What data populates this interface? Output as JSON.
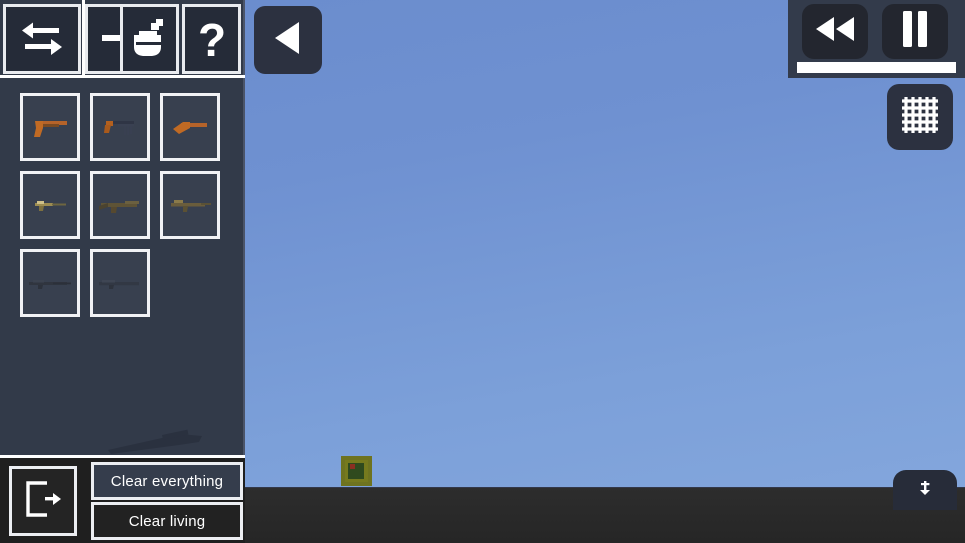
{
  "scene": {
    "sky_color_top": "#6a8ccd",
    "sky_color_bottom": "#83a6dc",
    "ground_color": "#2b2b2b",
    "entity": {
      "name": "crate-entity",
      "color": "#767a1e"
    }
  },
  "sidebar": {
    "background": "#323a49",
    "toolbar": [
      {
        "id": "swap-button",
        "icon": "swap-arrows-icon",
        "label": "Swap"
      },
      {
        "id": "arrow-button",
        "icon": "arrow-right-icon",
        "label": "Arrow"
      },
      {
        "id": "grenade-button",
        "icon": "grenade-icon",
        "label": "Grenade"
      },
      {
        "id": "help-button",
        "icon": "question-mark-icon",
        "label": "Help"
      }
    ],
    "weapons": [
      {
        "id": "weapon-pistol",
        "label": "Pistol",
        "tint": "#c2641e"
      },
      {
        "id": "weapon-machine-pistol",
        "label": "Machine Pistol",
        "tint": "#b35c1c"
      },
      {
        "id": "weapon-sawed-off",
        "label": "Sawed-off",
        "tint": "#c4661f"
      },
      {
        "id": "weapon-smg",
        "label": "SMG",
        "tint": "#8a7a4a"
      },
      {
        "id": "weapon-assault-rifle",
        "label": "Assault Rifle",
        "tint": "#6e5f3a"
      },
      {
        "id": "weapon-carbine",
        "label": "Carbine",
        "tint": "#6a5d3c"
      },
      {
        "id": "weapon-sniper",
        "label": "Sniper Rifle",
        "tint": "#3c4150"
      },
      {
        "id": "weapon-rifle",
        "label": "Rifle",
        "tint": "#3e4352"
      }
    ],
    "preview": {
      "name": "weapon-preview",
      "label": "Rifle preview"
    },
    "bottom": {
      "exit_label": "Exit",
      "exit_icon": "exit-icon",
      "clear_everything_label": "Clear everything",
      "clear_living_label": "Clear living",
      "clear_everything_highlighted": true
    }
  },
  "controls": {
    "back_button": {
      "label": "Back",
      "icon": "triangle-left-icon"
    },
    "playback": {
      "rewind_label": "Rewind",
      "rewind_icon": "rewind-icon",
      "pause_label": "Pause",
      "pause_icon": "pause-icon",
      "speed_bar_name": "speed-bar",
      "speed_fill_percent": 100
    },
    "grid_button": {
      "label": "Toggle grid",
      "icon": "grid-icon"
    },
    "fab_button": {
      "label": "More",
      "icon": "anchor-icon"
    }
  }
}
